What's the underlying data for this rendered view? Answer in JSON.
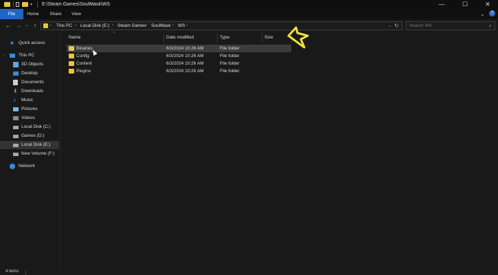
{
  "window": {
    "title": "E:\\Steam Games\\SoulMask\\WS",
    "controls": [
      "—",
      "☐",
      "✕"
    ]
  },
  "ribbon": {
    "tabs": [
      "File",
      "Home",
      "Share",
      "View"
    ],
    "expand_icon": "chevron-down-icon",
    "help_icon": "help-icon"
  },
  "address": {
    "crumbs": [
      "This PC",
      "Local Disk (E:)",
      "Steam Games",
      "SoulMask",
      "WS"
    ],
    "search_placeholder": "Search WS"
  },
  "nav": {
    "quick_access": "Quick access",
    "this_pc": "This PC",
    "items": [
      "3D Objects",
      "Desktop",
      "Documents",
      "Downloads",
      "Music",
      "Pictures",
      "Videos",
      "Local Disk (C:)",
      "Games (D:)",
      "Local Disk (E:)",
      "New Volume (F:)"
    ],
    "network": "Network",
    "selected": "Local Disk (E:)"
  },
  "columns": [
    "Name",
    "Date modified",
    "Type",
    "Size"
  ],
  "files": [
    {
      "name": "Binaries",
      "date": "6/3/2024 10:26 AM",
      "type": "File folder"
    },
    {
      "name": "Config",
      "date": "6/3/2024 10:26 AM",
      "type": "File folder"
    },
    {
      "name": "Content",
      "date": "6/3/2024 10:26 AM",
      "type": "File folder"
    },
    {
      "name": "Plugins",
      "date": "6/3/2024 10:26 AM",
      "type": "File folder"
    }
  ],
  "status": {
    "item_count": "4 items"
  },
  "colors": {
    "folder": "#e9c440",
    "file_tab": "#2266c4",
    "annotation": "#f1e23a"
  }
}
